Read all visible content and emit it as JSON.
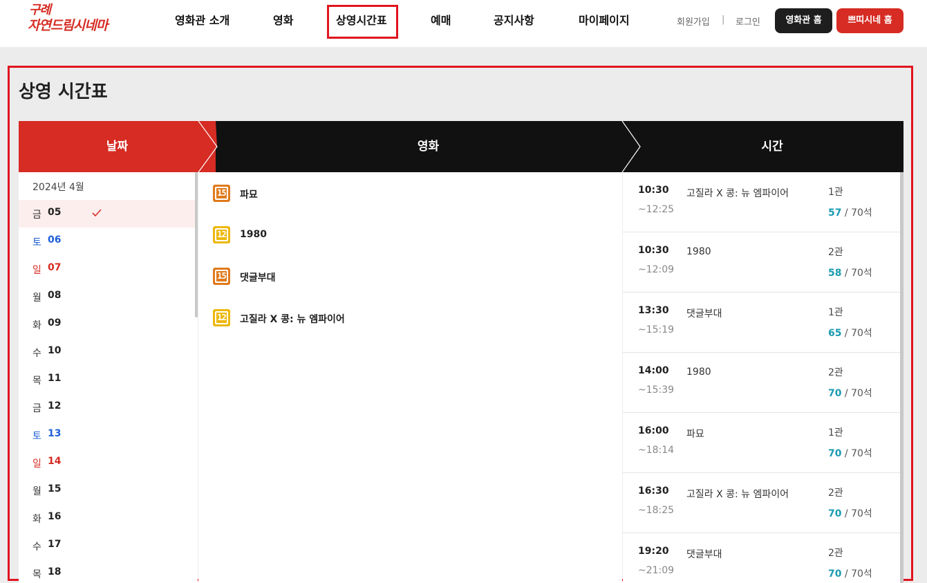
{
  "logo": {
    "line1": "구례",
    "line2": "자연드림시네마"
  },
  "nav": [
    {
      "label": "영화관 소개"
    },
    {
      "label": "영화"
    },
    {
      "label": "상영시간표"
    },
    {
      "label": "예매"
    },
    {
      "label": "공지사항"
    },
    {
      "label": "마이페이지"
    }
  ],
  "util": {
    "signup": "회원가입",
    "separator": "|",
    "login": "로그인"
  },
  "buttons": {
    "theater_home": "영화관 홈",
    "ppitti_home": "쁘띠시네 홈"
  },
  "page_title": "상영 시간표",
  "steps": {
    "date": "날짜",
    "movie": "영화",
    "time": "시간"
  },
  "date_month": "2024년 4월",
  "dates": [
    {
      "dow": "금",
      "day": "05",
      "type": "weekday",
      "selected": true
    },
    {
      "dow": "토",
      "day": "06",
      "type": "sat"
    },
    {
      "dow": "일",
      "day": "07",
      "type": "sun"
    },
    {
      "dow": "월",
      "day": "08",
      "type": "weekday"
    },
    {
      "dow": "화",
      "day": "09",
      "type": "weekday"
    },
    {
      "dow": "수",
      "day": "10",
      "type": "weekday"
    },
    {
      "dow": "목",
      "day": "11",
      "type": "weekday"
    },
    {
      "dow": "금",
      "day": "12",
      "type": "weekday"
    },
    {
      "dow": "토",
      "day": "13",
      "type": "sat"
    },
    {
      "dow": "일",
      "day": "14",
      "type": "sun"
    },
    {
      "dow": "월",
      "day": "15",
      "type": "weekday"
    },
    {
      "dow": "화",
      "day": "16",
      "type": "weekday"
    },
    {
      "dow": "수",
      "day": "17",
      "type": "weekday"
    },
    {
      "dow": "목",
      "day": "18",
      "type": "weekday"
    }
  ],
  "movies": [
    {
      "rating": "15",
      "title": "파묘"
    },
    {
      "rating": "12",
      "title": "1980"
    },
    {
      "rating": "15",
      "title": "댓글부대"
    },
    {
      "rating": "12",
      "title": "고질라 X 콩: 뉴 엠파이어"
    }
  ],
  "showtimes": [
    {
      "start": "10:30",
      "end": "~12:25",
      "title": "고질라 X 콩: 뉴 엠파이어",
      "hall": "1관",
      "available": "57",
      "total": " / 70석"
    },
    {
      "start": "10:30",
      "end": "~12:09",
      "title": "1980",
      "hall": "2관",
      "available": "58",
      "total": " / 70석"
    },
    {
      "start": "13:30",
      "end": "~15:19",
      "title": "댓글부대",
      "hall": "1관",
      "available": "65",
      "total": " / 70석"
    },
    {
      "start": "14:00",
      "end": "~15:39",
      "title": "1980",
      "hall": "2관",
      "available": "70",
      "total": " / 70석"
    },
    {
      "start": "16:00",
      "end": "~18:14",
      "title": "파묘",
      "hall": "1관",
      "available": "70",
      "total": " / 70석"
    },
    {
      "start": "16:30",
      "end": "~18:25",
      "title": "고질라 X 콩: 뉴 엠파이어",
      "hall": "2관",
      "available": "70",
      "total": " / 70석"
    },
    {
      "start": "19:20",
      "end": "~21:09",
      "title": "댓글부대",
      "hall": "2관",
      "available": "70",
      "total": " / 70석"
    }
  ],
  "colors": {
    "brand_red": "#d62c23",
    "dark": "#111111",
    "seat_available": "#1a9bb0",
    "saturday": "#1f5fd6",
    "sunday": "#d62c23"
  }
}
